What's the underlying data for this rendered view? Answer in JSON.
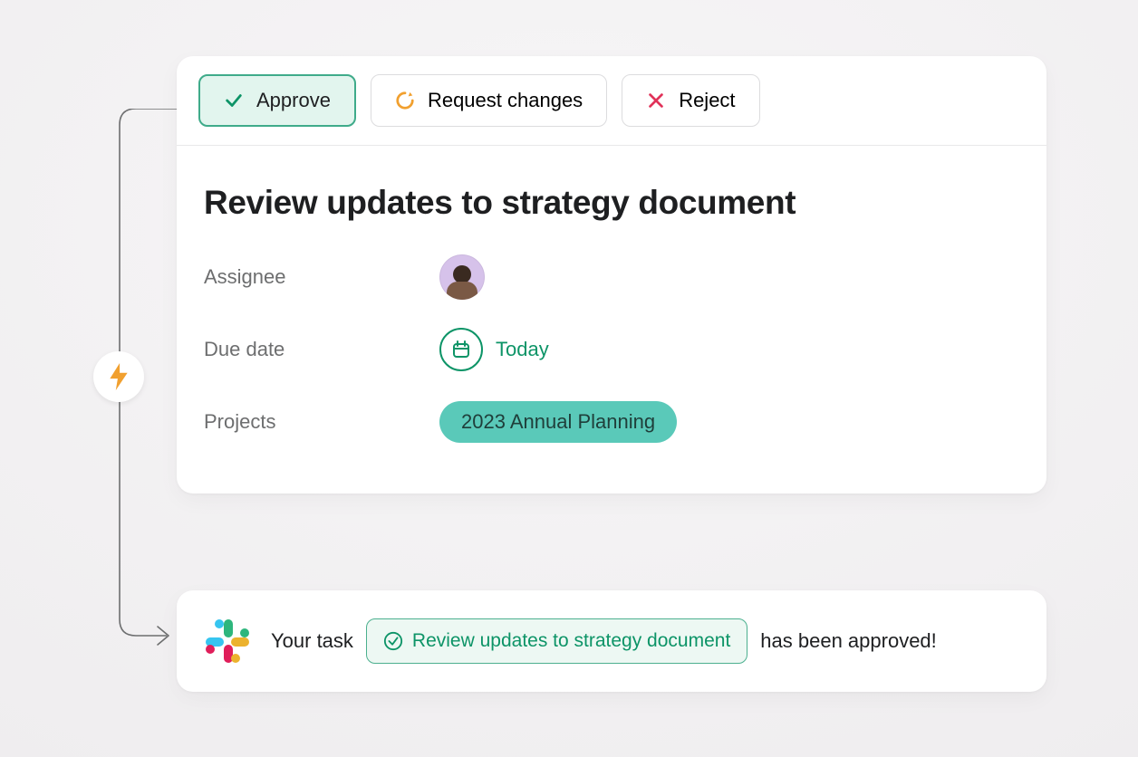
{
  "actions": {
    "approve": "Approve",
    "request_changes": "Request changes",
    "reject": "Reject"
  },
  "task": {
    "title": "Review updates to strategy document",
    "fields": {
      "assignee_label": "Assignee",
      "due_date_label": "Due date",
      "due_date_value": "Today",
      "projects_label": "Projects",
      "project_value": "2023 Annual Planning"
    }
  },
  "notification": {
    "prefix": "Your task",
    "task_name": "Review updates to strategy document",
    "suffix": "has been approved!"
  },
  "colors": {
    "green": "#0d9467",
    "teal": "#5ac9b9",
    "orange": "#f1a02f",
    "red": "#e13259"
  }
}
